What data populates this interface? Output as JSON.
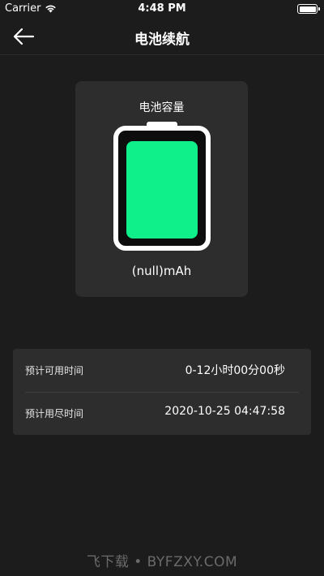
{
  "status_bar": {
    "carrier": "Carrier",
    "time": "4:48 PM",
    "icons": [
      "wifi-icon",
      "battery-icon"
    ]
  },
  "nav": {
    "title": "电池续航",
    "back_icon": "arrow-left-icon"
  },
  "battery_card": {
    "title": "电池容量",
    "capacity": "(null)mAh",
    "fill_fraction": 1.0,
    "fill_color": "#0ff08a",
    "frame_color": "#ffffff"
  },
  "info": [
    {
      "label": "预计可用时间",
      "value": "0-12小时00分00秒"
    },
    {
      "label": "预计用尽时间",
      "value": "2020-10-25 04:47:58"
    }
  ],
  "watermark": "飞下载 • BYFZXY.COM",
  "colors": {
    "background": "#1c1c1c",
    "card": "#2d2d2d",
    "accent": "#0ff08a"
  }
}
